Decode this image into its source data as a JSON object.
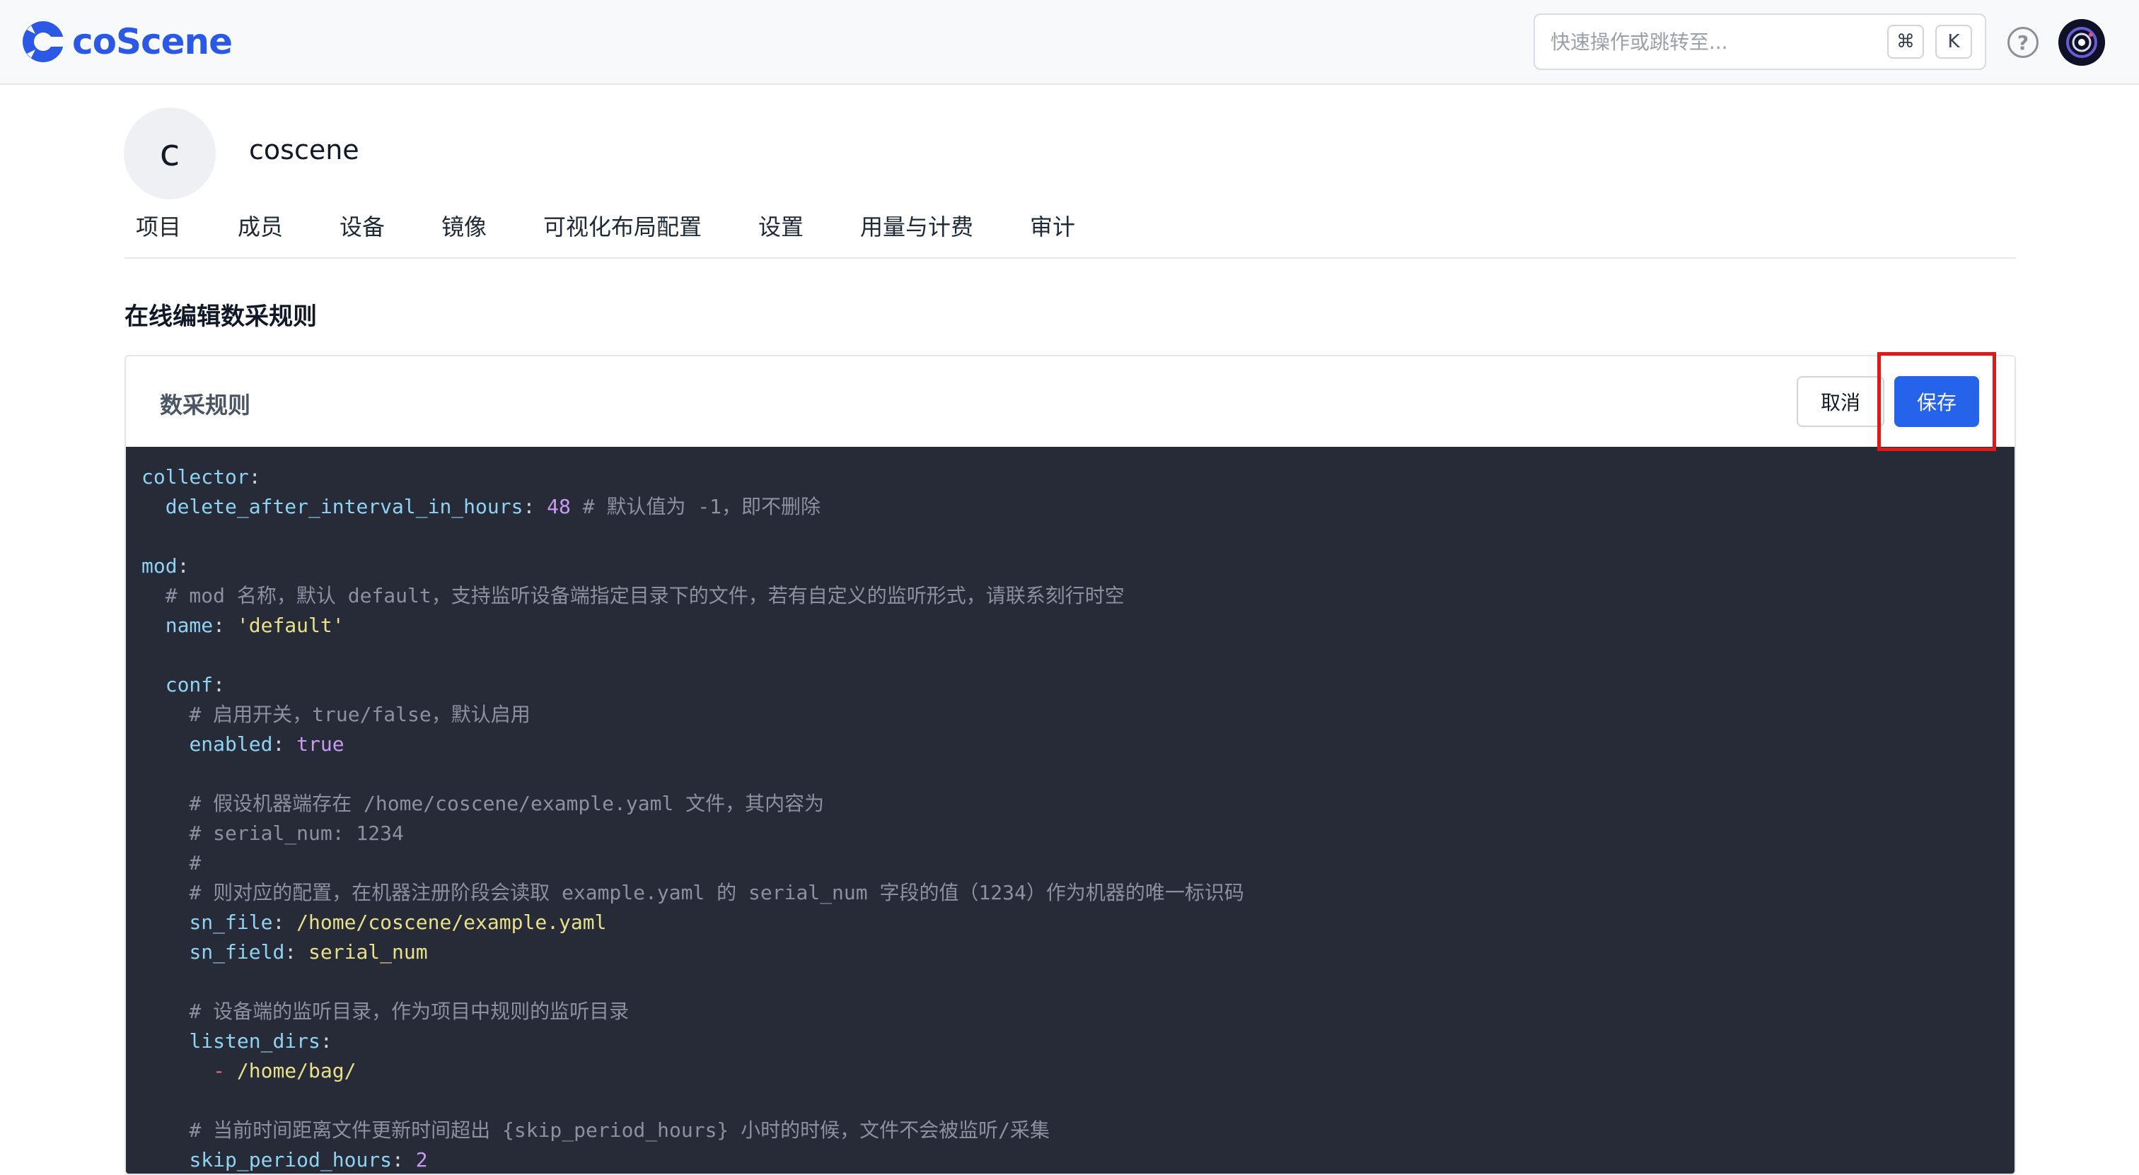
{
  "brand": {
    "name": "coScene",
    "color": "#2b59e6"
  },
  "search": {
    "placeholder": "快速操作或跳转至...",
    "shortcut_cmd": "⌘",
    "shortcut_key": "K"
  },
  "help_icon": "?",
  "org": {
    "avatar_letter": "c",
    "name": "coscene"
  },
  "tabs": [
    "项目",
    "成员",
    "设备",
    "镜像",
    "可视化布局配置",
    "设置",
    "用量与计费",
    "审计"
  ],
  "page": {
    "title": "在线编辑数采规则"
  },
  "card": {
    "title": "数采规则",
    "cancel_label": "取消",
    "save_label": "保存"
  },
  "code_lines": [
    [
      [
        "k",
        "collector"
      ],
      [
        "p",
        ":"
      ]
    ],
    [
      [
        "p",
        "  "
      ],
      [
        "k",
        "delete_after_interval_in_hours"
      ],
      [
        "p",
        ": "
      ],
      [
        "n",
        "48"
      ],
      [
        "c",
        " # 默认值为 -1，即不删除"
      ]
    ],
    [],
    [
      [
        "k",
        "mod"
      ],
      [
        "p",
        ":"
      ]
    ],
    [
      [
        "c",
        "  # mod 名称，默认 default，支持监听设备端指定目录下的文件，若有自定义的监听形式，请联系刻行时空"
      ]
    ],
    [
      [
        "p",
        "  "
      ],
      [
        "k",
        "name"
      ],
      [
        "p",
        ": "
      ],
      [
        "s",
        "'default'"
      ]
    ],
    [],
    [
      [
        "p",
        "  "
      ],
      [
        "k",
        "conf"
      ],
      [
        "p",
        ":"
      ]
    ],
    [
      [
        "c",
        "    # 启用开关，true/false，默认启用"
      ]
    ],
    [
      [
        "p",
        "    "
      ],
      [
        "k",
        "enabled"
      ],
      [
        "p",
        ": "
      ],
      [
        "b",
        "true"
      ]
    ],
    [],
    [
      [
        "c",
        "    # 假设机器端存在 /home/coscene/example.yaml 文件，其内容为"
      ]
    ],
    [
      [
        "c",
        "    # serial_num: 1234"
      ]
    ],
    [
      [
        "c",
        "    #"
      ]
    ],
    [
      [
        "c",
        "    # 则对应的配置，在机器注册阶段会读取 example.yaml 的 serial_num 字段的值（1234）作为机器的唯一标识码"
      ]
    ],
    [
      [
        "p",
        "    "
      ],
      [
        "k",
        "sn_file"
      ],
      [
        "p",
        ": "
      ],
      [
        "s",
        "/home/coscene/example.yaml"
      ]
    ],
    [
      [
        "p",
        "    "
      ],
      [
        "k",
        "sn_field"
      ],
      [
        "p",
        ": "
      ],
      [
        "s",
        "serial_num"
      ]
    ],
    [],
    [
      [
        "c",
        "    # 设备端的监听目录，作为项目中规则的监听目录"
      ]
    ],
    [
      [
        "p",
        "    "
      ],
      [
        "k",
        "listen_dirs"
      ],
      [
        "p",
        ":"
      ]
    ],
    [
      [
        "p",
        "      "
      ],
      [
        "d",
        "- "
      ],
      [
        "s",
        "/home/bag/"
      ]
    ],
    [],
    [
      [
        "c",
        "    # 当前时间距离文件更新时间超出 {skip_period_hours} 小时的时候，文件不会被监听/采集"
      ]
    ],
    [
      [
        "p",
        "    "
      ],
      [
        "k",
        "skip_period_hours"
      ],
      [
        "p",
        ": "
      ],
      [
        "n",
        "2"
      ]
    ]
  ]
}
